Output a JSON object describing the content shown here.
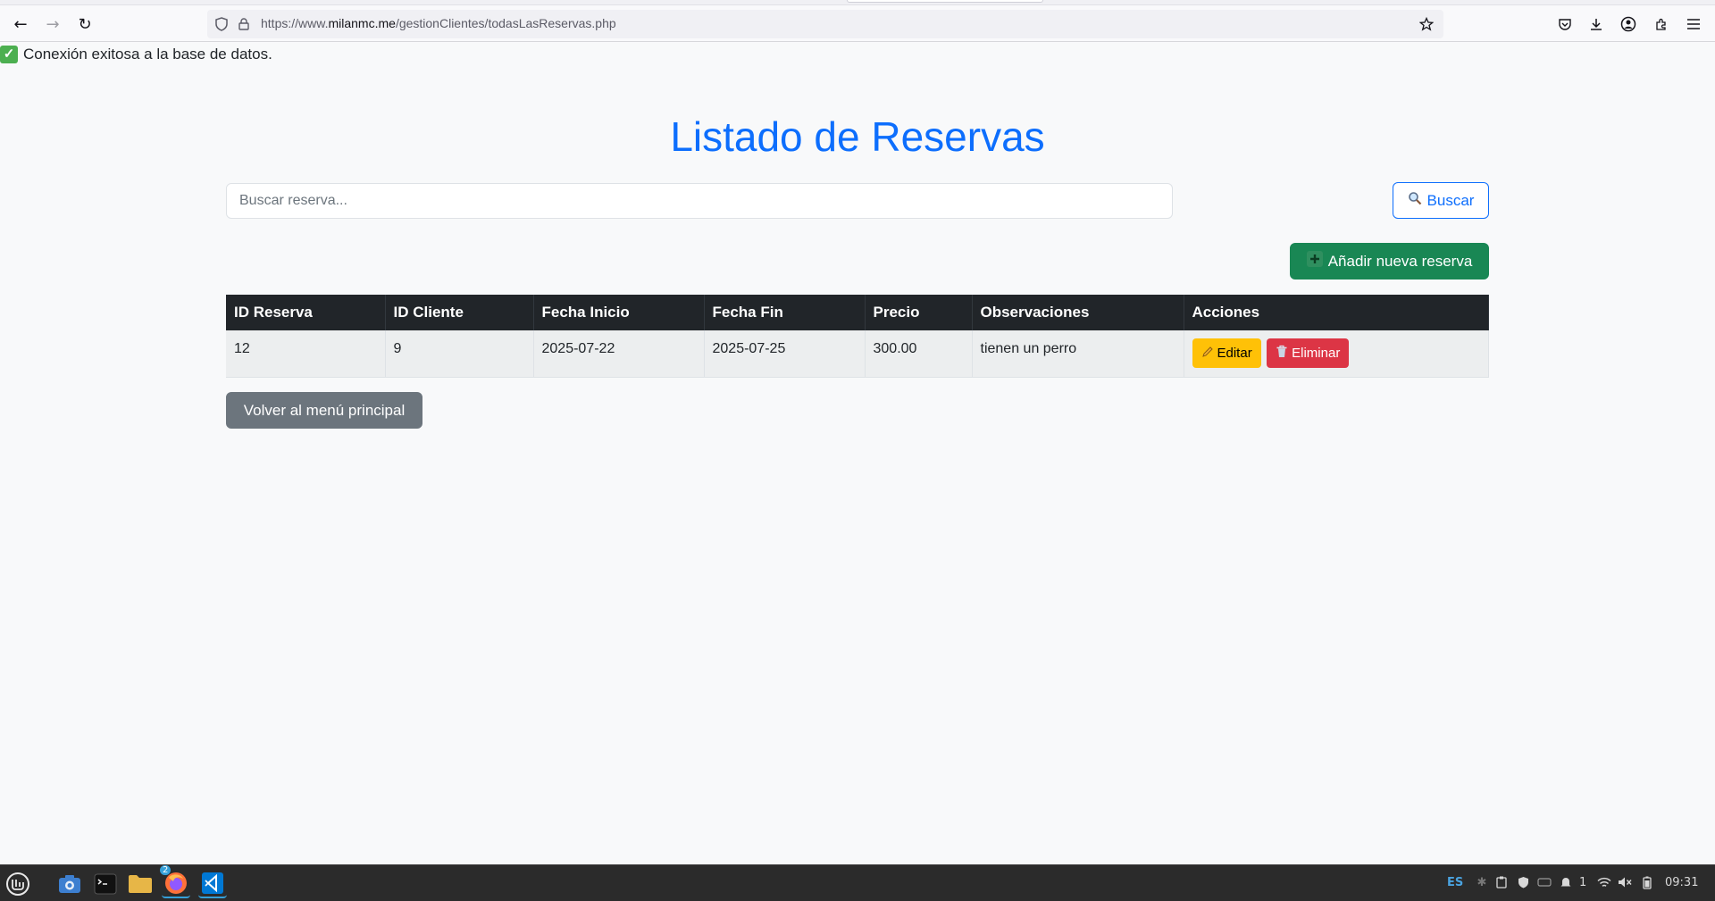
{
  "browser": {
    "url_prefix": "https://www.",
    "url_host": "milanmc.me",
    "url_path": "/gestionClientes/todasLasReservas.php",
    "back_icon": "←",
    "forward_icon": "→",
    "reload_icon": "↻"
  },
  "page": {
    "db_message": "Conexión exitosa a la base de datos.",
    "title": "Listado de Reservas",
    "search_placeholder": "Buscar reserva...",
    "search_button": "Buscar",
    "add_button": "Añadir nueva reserva",
    "back_button": "Volver al menú principal"
  },
  "table": {
    "headers": [
      "ID Reserva",
      "ID Cliente",
      "Fecha Inicio",
      "Fecha Fin",
      "Precio",
      "Observaciones",
      "Acciones"
    ],
    "rows": [
      {
        "id_reserva": "12",
        "id_cliente": "9",
        "fecha_inicio": "2025-07-22",
        "fecha_fin": "2025-07-25",
        "precio": "300.00",
        "observaciones": "tienen un perro",
        "edit_label": "Editar",
        "delete_label": "Eliminar"
      }
    ]
  },
  "taskbar": {
    "firefox_badge": "2",
    "keyboard_layout": "ES",
    "notification_count": "1",
    "clock": "09:31"
  },
  "colors": {
    "primary": "#0d6efd",
    "success": "#198754",
    "secondary": "#6c757d",
    "warning": "#ffc107",
    "danger": "#dc3545",
    "table_header": "#212529"
  }
}
